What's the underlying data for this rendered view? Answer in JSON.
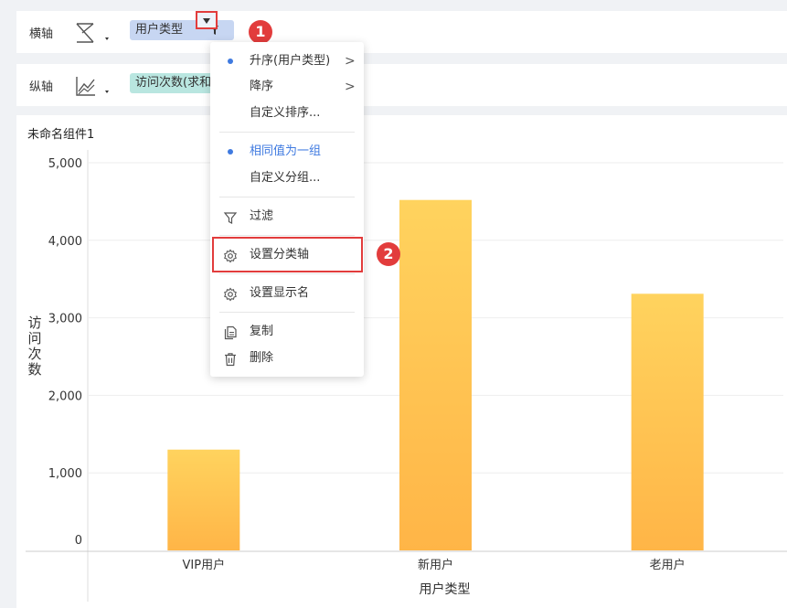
{
  "x_axis_row": {
    "label": "横轴",
    "field": "用户类型"
  },
  "y_axis_row": {
    "label": "纵轴",
    "field": "访问次数(求和)"
  },
  "annotations": {
    "badge_1": "1",
    "badge_2": "2"
  },
  "menu": {
    "items": [
      {
        "label": "升序(用户类型)",
        "dot": true,
        "arrow": true
      },
      {
        "label": "降序",
        "dot": false,
        "arrow": true
      },
      {
        "label": "自定义排序..."
      },
      {
        "label": "相同值为一组",
        "dot": true,
        "active": true
      },
      {
        "label": "自定义分组..."
      },
      {
        "label": "过滤",
        "icon": "filter-icon"
      },
      {
        "label": "设置分类轴",
        "icon": "gear-icon"
      },
      {
        "label": "设置显示名",
        "icon": "gear-icon"
      },
      {
        "label": "复制",
        "icon": "copy-icon"
      },
      {
        "label": "删除",
        "icon": "trash-icon"
      }
    ],
    "arrow_glyph": ">"
  },
  "chart_title": "未命名组件1",
  "colors": {
    "bar_top": "#ffd35e",
    "bar_bottom": "#ffb547",
    "accent": "#3f7ae0",
    "highlight": "#e23c3c"
  },
  "chart_data": {
    "type": "bar",
    "categories": [
      "VIP用户",
      "新用户",
      "老用户"
    ],
    "values": [
      1300,
      4520,
      3310
    ],
    "xlabel": "用户类型",
    "ylabel": "访问次数",
    "ylim": [
      0,
      5000
    ],
    "yticks": [
      0,
      1000,
      2000,
      3000,
      4000,
      5000
    ],
    "ytick_labels": [
      "0",
      "1,000",
      "2,000",
      "3,000",
      "4,000",
      "5,000"
    ],
    "grid": true
  }
}
